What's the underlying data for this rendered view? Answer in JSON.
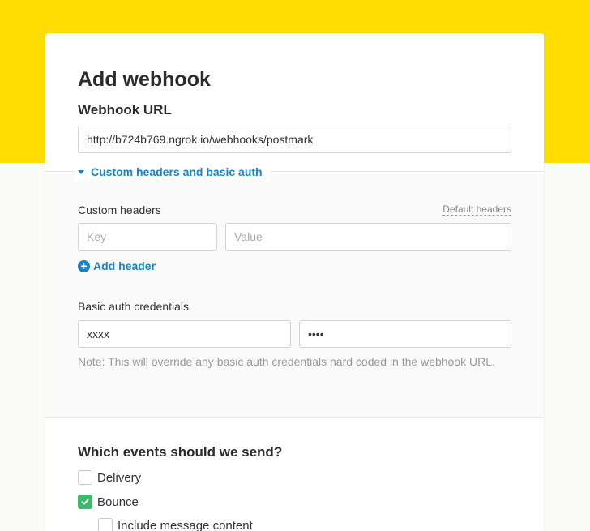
{
  "form": {
    "title": "Add webhook",
    "url_label": "Webhook URL",
    "url_value": "http://b724b769.ngrok.io/webhooks/postmark"
  },
  "advanced": {
    "toggle_label": "Custom headers and basic auth",
    "custom_headers_label": "Custom headers",
    "default_headers_link": "Default headers",
    "key_placeholder": "Key",
    "value_placeholder": "Value",
    "add_header_label": "Add header",
    "basic_auth_label": "Basic auth credentials",
    "auth_username": "xxxx",
    "auth_password": "xxxx",
    "note": "Note: This will override any basic auth credentials hard coded in the webhook URL."
  },
  "events": {
    "title": "Which events should we send?",
    "items": [
      {
        "label": "Delivery",
        "checked": false
      },
      {
        "label": "Bounce",
        "checked": true
      },
      {
        "label": "Include message content",
        "checked": false
      }
    ]
  },
  "colors": {
    "brand_yellow": "#ffdd00",
    "link_blue": "#1a82c4",
    "check_green": "#3dbb6b"
  }
}
